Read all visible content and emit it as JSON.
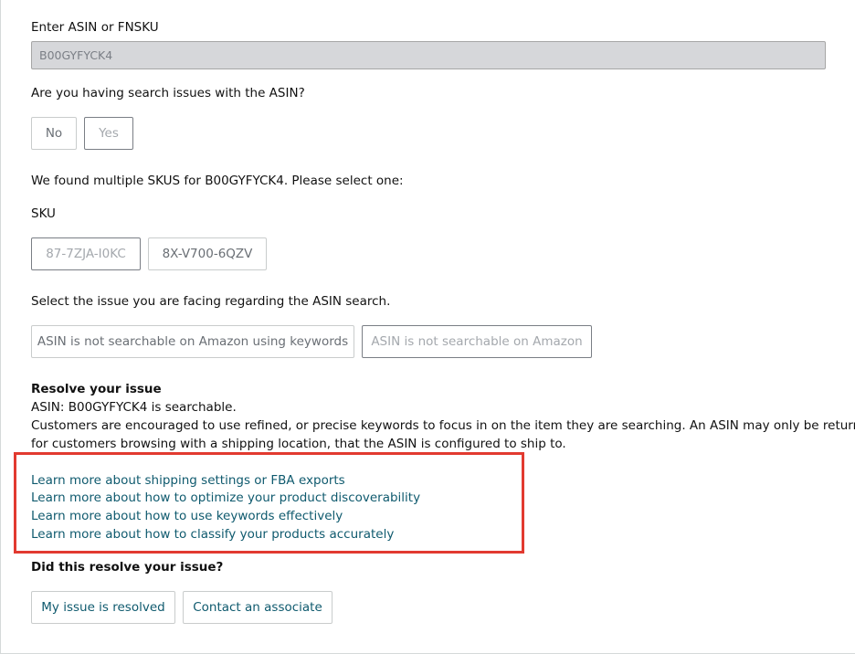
{
  "asin_section": {
    "label": "Enter ASIN or FNSKU",
    "value": "B00GYFYCK4"
  },
  "search_issue_question": {
    "label": "Are you having search issues with the ASIN?",
    "no_label": "No",
    "yes_label": "Yes"
  },
  "sku_section": {
    "intro": "We found multiple SKUS for B00GYFYCK4. Please select one:",
    "label": "SKU",
    "options": [
      "87-7ZJA-I0KC",
      "8X-V700-6QZV"
    ]
  },
  "issue_section": {
    "label": "Select the issue you are facing regarding the ASIN search.",
    "options": [
      "ASIN is not searchable on Amazon using keywords",
      "ASIN is not searchable on Amazon"
    ]
  },
  "resolve_section": {
    "title": "Resolve your issue",
    "status": "ASIN: B00GYFYCK4 is searchable.",
    "description_line1": "Customers are encouraged to use refined, or precise keywords to focus in on the item they are searching. An ASIN may only be returned",
    "description_line2": "for customers browsing with a shipping location, that the ASIN is configured to ship to."
  },
  "help_links": [
    "Learn more about shipping settings or FBA exports",
    "Learn more about how to optimize your product discoverability",
    "Learn more about how to use keywords effectively",
    "Learn more about how to classify your products accurately"
  ],
  "feedback": {
    "question": "Did this resolve your issue?",
    "resolved_label": "My issue is resolved",
    "contact_label": "Contact an associate"
  },
  "colors": {
    "link": "#0f5a6e",
    "highlight_border": "#e23a30",
    "disabled_input_bg": "#d6d7da"
  }
}
